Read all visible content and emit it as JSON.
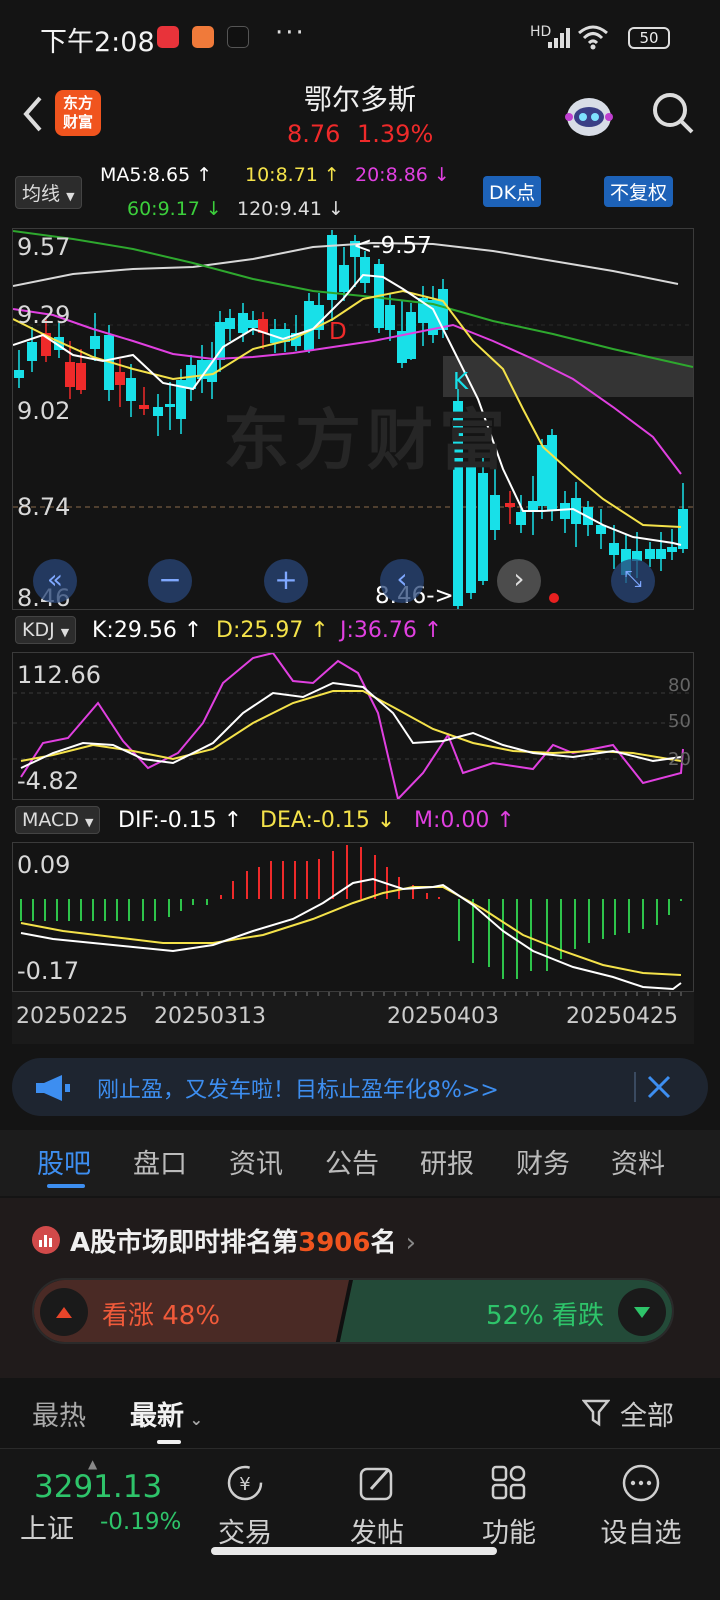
{
  "status_bar": {
    "time": "下午2:08",
    "dots": "···",
    "network": "HD",
    "battery": "50"
  },
  "header": {
    "logo_text_1": "东方",
    "logo_text_2": "财富",
    "stock_name": "鄂尔多斯",
    "price": "8.76",
    "change_pct": "1.39%"
  },
  "indicators": {
    "ma_selector": "均线",
    "ma5": "MA5:8.65 ↑",
    "ma10": "10:8.71 ↑",
    "ma20": "20:8.86 ↓",
    "ma60": "60:9.17 ↓",
    "ma120": "120:9.41 ↓",
    "dk_button": "DK点",
    "fq_button": "不复权"
  },
  "main_chart": {
    "y_labels": [
      "9.57",
      "9.29",
      "9.02",
      "8.74",
      "8.46"
    ],
    "high_marker": "<-9.57",
    "low_marker": "8.46->",
    "letter_d": "D",
    "letter_k": "K",
    "watermark": "东方财富",
    "controls": [
      "«",
      "−",
      "+",
      "‹",
      "›",
      "»"
    ]
  },
  "kdj": {
    "selector": "KDJ",
    "k": "K:29.56 ↑",
    "d": "D:25.97 ↑",
    "j": "J:36.76 ↑",
    "y_top": "112.66",
    "y_bottom": "-4.82",
    "levels": [
      "80",
      "50",
      "20"
    ]
  },
  "macd": {
    "selector": "MACD",
    "dif": "DIF:-0.15 ↑",
    "dea": "DEA:-0.15 ↓",
    "m": "M:0.00 ↑",
    "y_top": "0.09",
    "y_bottom": "-0.17"
  },
  "dates": [
    "20250225",
    "20250313",
    "20250403",
    "20250425"
  ],
  "banner": {
    "text": "刚止盈，又发车啦！目标止盈年化8%>>"
  },
  "tabs": [
    "股吧",
    "盘口",
    "资讯",
    "公告",
    "研报",
    "财务",
    "资料"
  ],
  "rank": {
    "prefix": "A股市场即时排名第",
    "number": "3906",
    "suffix": "名",
    "rise_label": "看涨 48%",
    "fall_label": "52% 看跌",
    "rise_pct": 48,
    "fall_pct": 52
  },
  "filters": {
    "hot": "最热",
    "latest": "最新",
    "all": "全部"
  },
  "bottom_nav": {
    "index_value": "3291.13",
    "index_name": "上证",
    "index_change": "-0.19%",
    "items": [
      "交易",
      "发帖",
      "功能",
      "设自选"
    ]
  },
  "colors": {
    "up": "#ef2a2a",
    "down": "#18e0e8",
    "accent_blue": "#3d8ef0",
    "brand_orange": "#f0541e",
    "ma5": "#ffffff",
    "ma10": "#f4e24a",
    "ma20": "#e040e0",
    "ma60": "#2ea82e",
    "ma120": "#d8d8d8"
  }
}
